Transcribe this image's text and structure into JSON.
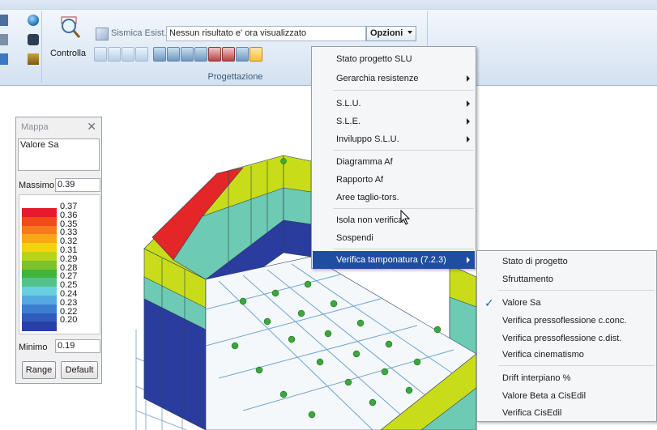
{
  "ribbon": {
    "controlla_label": "Controlla",
    "sismica_label": "Sismica Esist.",
    "result_combo_value": "Nessun risultato e' ora visualizzato",
    "opzioni_label": "Opzioni",
    "group_caption": "Progettazione"
  },
  "mappa": {
    "title": "Mappa",
    "close_glyph": "✕",
    "description": "Valore Sa",
    "max_label": "Massimo",
    "max_value": "0.39",
    "min_label": "Minimo",
    "min_value": "0.19",
    "range_button": "Range",
    "default_button": "Default",
    "legend": [
      {
        "value": "0.37",
        "color": "#e8192c"
      },
      {
        "value": "0.36",
        "color": "#f14a1f"
      },
      {
        "value": "0.35",
        "color": "#f57a1a"
      },
      {
        "value": "0.33",
        "color": "#f9a714"
      },
      {
        "value": "0.32",
        "color": "#f3d20e"
      },
      {
        "value": "0.31",
        "color": "#b8d418"
      },
      {
        "value": "0.29",
        "color": "#7cc22a"
      },
      {
        "value": "0.28",
        "color": "#3fb33a"
      },
      {
        "value": "0.27",
        "color": "#53c28c"
      },
      {
        "value": "0.25",
        "color": "#68cfe0"
      },
      {
        "value": "0.24",
        "color": "#56a9e0"
      },
      {
        "value": "0.23",
        "color": "#3c7fd0"
      },
      {
        "value": "0.22",
        "color": "#2f5bbd"
      },
      {
        "value": "0.20",
        "color": "#2a3fa6"
      }
    ]
  },
  "menu": {
    "items": [
      {
        "label": "Stato progetto SLU"
      },
      {
        "label": "Gerarchia resistenze",
        "submenu": true
      },
      {
        "label": "S.L.U.",
        "submenu": true
      },
      {
        "label": "S.L.E.",
        "submenu": true
      },
      {
        "label": "Inviluppo S.L.U.",
        "submenu": true
      },
      {
        "label": "Diagramma Af"
      },
      {
        "label": "Rapporto Af"
      },
      {
        "label": "Aree taglio-tors."
      },
      {
        "label": "Isola non verifica"
      },
      {
        "label": "Sospendi"
      },
      {
        "label": "Verifica tamponatura (7.2.3)",
        "submenu": true,
        "highlighted": true
      }
    ]
  },
  "submenu": {
    "items": [
      {
        "label": "Stato di progetto"
      },
      {
        "label": "Sfruttamento"
      },
      {
        "label": "Valore Sa",
        "checked": true
      },
      {
        "label": "Verifica pressoflessione c.conc."
      },
      {
        "label": "Verifica pressoflessione c.dist."
      },
      {
        "label": "Verifica cinematismo"
      },
      {
        "label": "Drift interpiano %"
      },
      {
        "label": "Valore Beta a CisEdil"
      },
      {
        "label": "Verifica CisEdil"
      }
    ]
  },
  "colors": {
    "highlight": "#1f4ea1",
    "wall_red": "#e32626",
    "wall_yellow": "#c8dc1a",
    "wall_teal": "#6ccbb2",
    "wall_blue": "#2a3c9e",
    "floor_green": "#3aa83a"
  }
}
